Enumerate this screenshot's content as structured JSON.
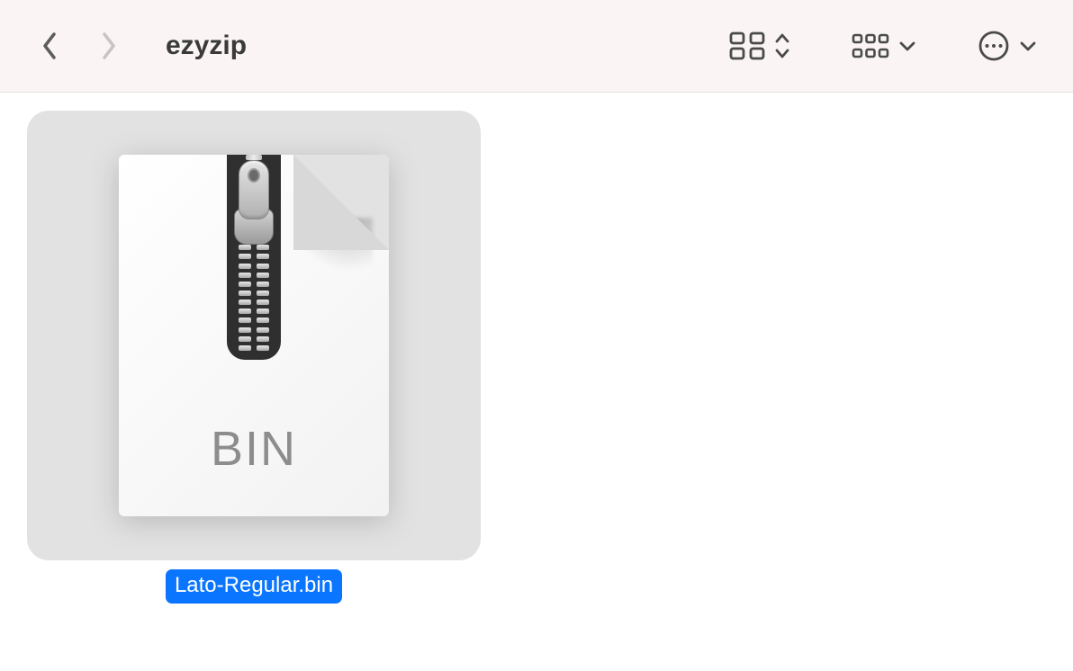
{
  "toolbar": {
    "folder_name": "ezyzip"
  },
  "files": [
    {
      "name": "Lato-Regular.bin",
      "extension_label": "BIN",
      "selected": true
    }
  ]
}
